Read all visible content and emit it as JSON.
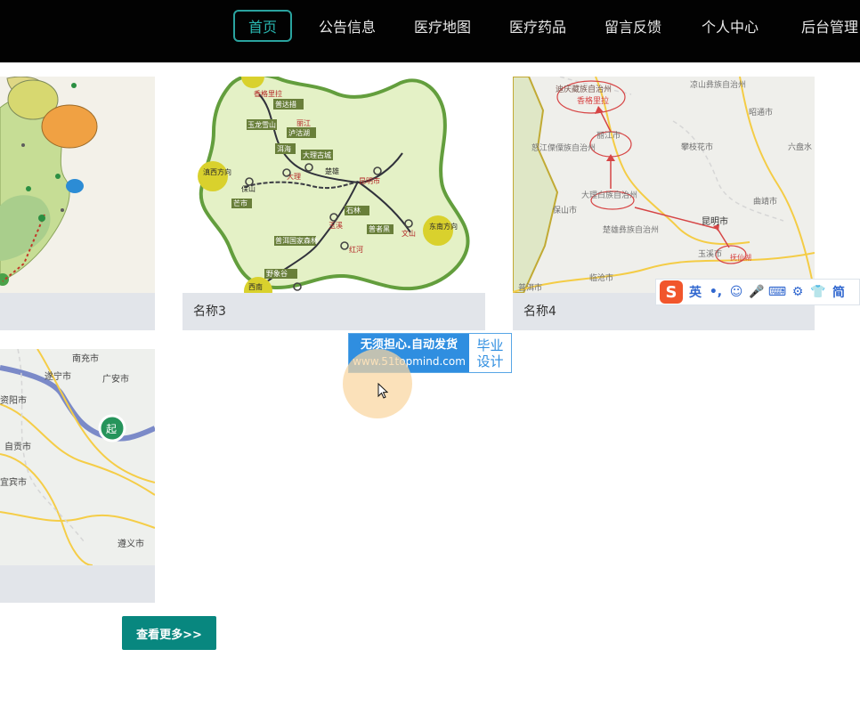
{
  "nav": {
    "items": [
      {
        "label": "首页",
        "active": true
      },
      {
        "label": "公告信息",
        "active": false
      },
      {
        "label": "医疗地图",
        "active": false
      },
      {
        "label": "医疗药品",
        "active": false
      },
      {
        "label": "留言反馈",
        "active": false
      },
      {
        "label": "个人中心",
        "active": false
      },
      {
        "label": "后台管理",
        "active": false
      }
    ]
  },
  "cards": {
    "items": [
      {
        "caption": ""
      },
      {
        "caption": "名称3"
      },
      {
        "caption": "名称4"
      },
      {
        "caption": ""
      }
    ],
    "map3": {
      "labels": [
        "香格里拉",
        "普达措",
        "丽江",
        "玉龙雪山",
        "泸沽湖",
        "洱海",
        "大理古城",
        "大理",
        "楚雄",
        "昆明市",
        "滇西方向",
        "保山",
        "芒市",
        "石林",
        "东南方向",
        "玉溪",
        "红河",
        "普者黑",
        "文山",
        "西南",
        "野象谷",
        "普洱国家森林"
      ]
    },
    "map4": {
      "labels": [
        "迪庆藏族自治州",
        "香格里拉",
        "丽江市",
        "凉山彝族自治州",
        "攀枝花市",
        "昭通市",
        "六盘水",
        "怒江傈僳族自治州",
        "大理白族自治州",
        "昆明市",
        "曲靖市",
        "保山市",
        "楚雄彝族自治州",
        "玉溪市",
        "抚仙湖",
        "临沧市",
        "普洱市"
      ]
    },
    "map5": {
      "labels": [
        "南充市",
        "遂宁市",
        "广安市",
        "资阳市",
        "自贡市",
        "宜宾市",
        "遵义市",
        "起"
      ]
    }
  },
  "more_button": {
    "label": "查看更多>>"
  },
  "watermark": {
    "line1": "无须担心.自动发货",
    "line2": "www.51topmind.com",
    "right1": "毕业",
    "right2": "设计"
  },
  "ime": {
    "logo": "S",
    "items": [
      "英",
      "•,",
      "☺",
      "🎤",
      "⌨",
      "⚙",
      "👕",
      "简"
    ]
  },
  "colors": {
    "topbar": "#020202",
    "nav_active": "#29b6b0",
    "caption_bg": "#e2e5ea",
    "button": "#08877f"
  }
}
